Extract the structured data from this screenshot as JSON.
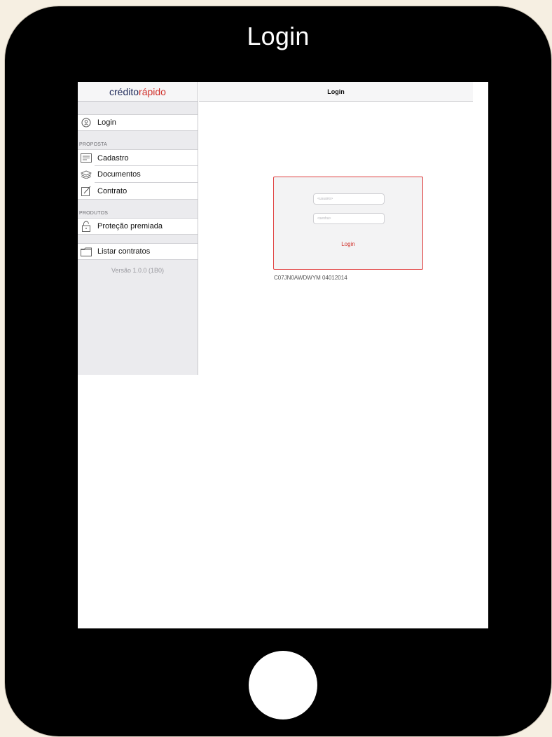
{
  "device": {
    "title": "Login"
  },
  "sidebar": {
    "logo_part1": "crédito",
    "logo_part2": "rápido",
    "login_item": {
      "label": "Login",
      "icon": "user-circle-icon"
    },
    "proposta_label": "PROPOSTA",
    "proposta_items": [
      {
        "label": "Cadastro",
        "icon": "form-icon"
      },
      {
        "label": "Documentos",
        "icon": "documents-stack-icon"
      },
      {
        "label": "Contrato",
        "icon": "contract-edit-icon"
      }
    ],
    "produtos_label": "PRODUTOS",
    "produtos_items": [
      {
        "label": "Proteção premiada",
        "icon": "lock-icon"
      }
    ],
    "listar_item": {
      "label": "Listar contratos",
      "icon": "folder-icon"
    },
    "version": "Versão 1.0.0 (1B0)"
  },
  "detail": {
    "title": "Login",
    "form": {
      "user_placeholder": "<usuário>",
      "password_placeholder": "<senha>",
      "submit_label": "Login"
    },
    "serial": "C07JN0AWDWYM 04012014"
  },
  "colors": {
    "brand_dark": "#1f2a5a",
    "brand_red": "#d0302a",
    "device_frame": "#000000"
  }
}
